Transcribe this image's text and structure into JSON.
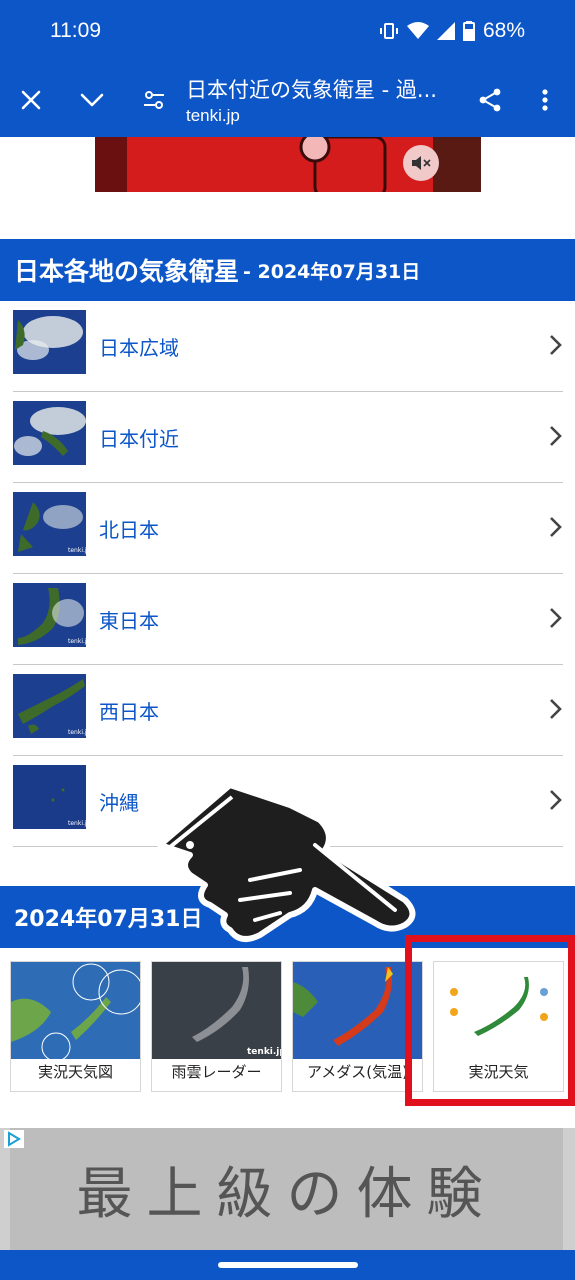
{
  "status": {
    "time": "11:09",
    "battery": "68%"
  },
  "toolbar": {
    "title": "日本付近の気象衛星 - 過...",
    "url": "tenki.jp"
  },
  "section1": {
    "title": "日本各地の気象衛星",
    "date": " - 2024年07月31日"
  },
  "list": [
    {
      "label": "日本広域"
    },
    {
      "label": "日本付近"
    },
    {
      "label": "北日本"
    },
    {
      "label": "東日本"
    },
    {
      "label": "西日本"
    },
    {
      "label": "沖縄"
    }
  ],
  "section2": {
    "title": "2024年07月31日"
  },
  "cards": [
    {
      "caption": "実況天気図"
    },
    {
      "caption": "雨雲レーダー"
    },
    {
      "caption": "アメダス(気温)"
    },
    {
      "caption": "実況天気"
    }
  ],
  "ad_bottom": {
    "text": "最上級の体験"
  },
  "colors": {
    "brand": "#0d56c8",
    "highlight": "#e0101c"
  }
}
